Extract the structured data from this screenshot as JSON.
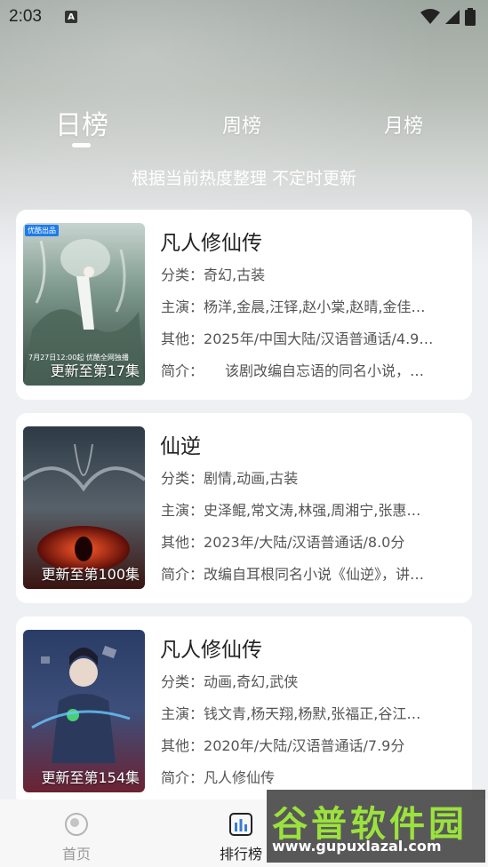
{
  "status_bar": {
    "time": "2:03",
    "notification_icon": "a-letter-icon",
    "icons": [
      "wifi-icon",
      "signal-icon",
      "battery-icon"
    ]
  },
  "tabs": [
    {
      "label": "日榜",
      "active": true
    },
    {
      "label": "周榜",
      "active": false
    },
    {
      "label": "月榜",
      "active": false
    }
  ],
  "subtitle": "根据当前热度整理 不定时更新",
  "labels": {
    "genre": "分类：",
    "cast": "主演：",
    "other": "其他：",
    "synopsis": "简介："
  },
  "items": [
    {
      "title": "凡人修仙传",
      "episodes": "更新至第17集",
      "badge": "优酷出品",
      "note": "7月27日12:00起 优酷全网独播",
      "genre": "奇幻,古装",
      "cast": "杨洋,金晨,汪铎,赵小棠,赵晴,金佳…",
      "other": "2025年/中国大陆/汉语普通话/4.9…",
      "synopsis": "　　该剧改编自忘语的同名小说，…"
    },
    {
      "title": "仙逆",
      "episodes": "更新至第100集",
      "genre": "剧情,动画,古装",
      "cast": "史泽鲲,常文涛,林强,周湘宁,张惠…",
      "other": "2023年/大陆/汉语普通话/8.0分",
      "synopsis": "改编自耳根同名小说《仙逆》，讲…"
    },
    {
      "title": "凡人修仙传",
      "episodes": "更新至第154集",
      "genre": "动画,奇幻,武侠",
      "cast": "钱文青,杨天翔,杨默,张福正,谷江…",
      "other": "2020年/大陆/汉语普通话/7.9分",
      "synopsis": "凡人修仙传"
    }
  ],
  "bottom_nav": [
    {
      "label": "首页",
      "icon": "home-icon",
      "active": false
    },
    {
      "label": "排行榜",
      "icon": "ranking-icon",
      "active": true
    }
  ],
  "watermark": {
    "title": "谷普软件园",
    "url": "www.gupuxlazal.com"
  }
}
